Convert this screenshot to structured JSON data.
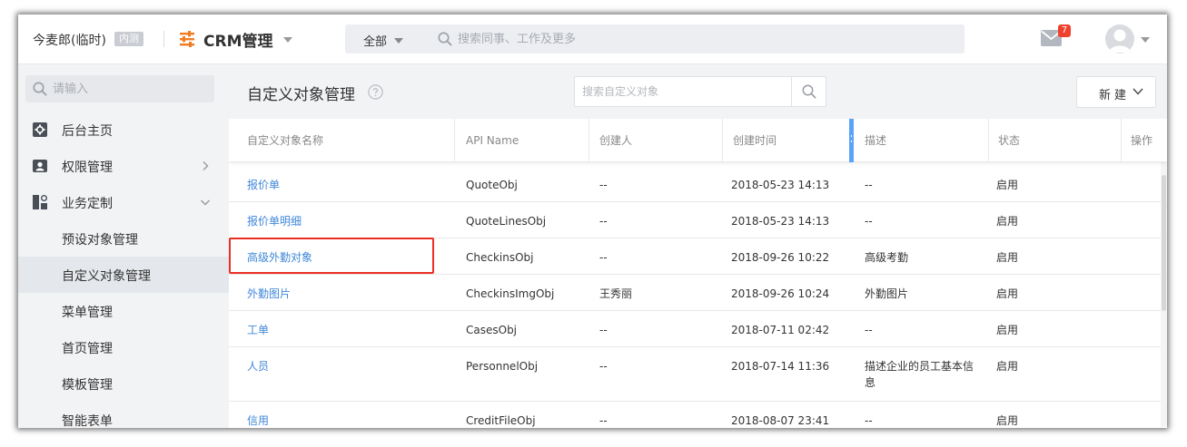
{
  "header": {
    "company": "今麦郎(临时)",
    "badge": "内测",
    "app_title": "CRM管理",
    "search_scope": "全部",
    "search_placeholder": "搜索同事、工作及更多",
    "mail_count": "7",
    "accent_color": "#f07c22"
  },
  "sidebar": {
    "search_placeholder": "请输入",
    "items": [
      {
        "label": "后台主页",
        "icon": "dashboard-icon"
      },
      {
        "label": "权限管理",
        "icon": "user-card-icon",
        "chevron": "right"
      },
      {
        "label": "业务定制",
        "icon": "modules-icon",
        "chevron": "down"
      }
    ],
    "sub_items": [
      {
        "label": "预设对象管理"
      },
      {
        "label": "自定义对象管理",
        "active": true
      },
      {
        "label": "菜单管理"
      },
      {
        "label": "首页管理"
      },
      {
        "label": "模板管理"
      },
      {
        "label": "智能表单"
      }
    ]
  },
  "main": {
    "title": "自定义对象管理",
    "search_placeholder": "搜索自定义对象",
    "new_button": "新建",
    "columns": [
      "自定义对象名称",
      "API Name",
      "创建人",
      "创建时间",
      "描述",
      "状态",
      "操作"
    ],
    "rows": [
      {
        "name": "报价单",
        "api": "QuoteObj",
        "creator": "--",
        "time": "2018-05-23 14:13",
        "desc": "--",
        "status": "启用"
      },
      {
        "name": "报价单明细",
        "api": "QuoteLinesObj",
        "creator": "--",
        "time": "2018-05-23 14:13",
        "desc": "--",
        "status": "启用"
      },
      {
        "name": "高级外勤对象",
        "api": "CheckinsObj",
        "creator": "--",
        "time": "2018-09-26 10:22",
        "desc": "高级考勤",
        "status": "启用"
      },
      {
        "name": "外勤图片",
        "api": "CheckinsImgObj",
        "creator": "王秀丽",
        "time": "2018-09-26 10:24",
        "desc": "外勤图片",
        "status": "启用"
      },
      {
        "name": "工单",
        "api": "CasesObj",
        "creator": "--",
        "time": "2018-07-11 02:42",
        "desc": "--",
        "status": "启用"
      },
      {
        "name": "人员",
        "api": "PersonnelObj",
        "creator": "--",
        "time": "2018-07-14 11:36",
        "desc": "描述企业的员工基本信息",
        "status": "启用"
      },
      {
        "name": "信用",
        "api": "CreditFileObj",
        "creator": "--",
        "time": "2018-08-07 23:41",
        "desc": "--",
        "status": "启用"
      }
    ],
    "link_color": "#3f87d8",
    "highlight_color": "#ec2e24"
  }
}
